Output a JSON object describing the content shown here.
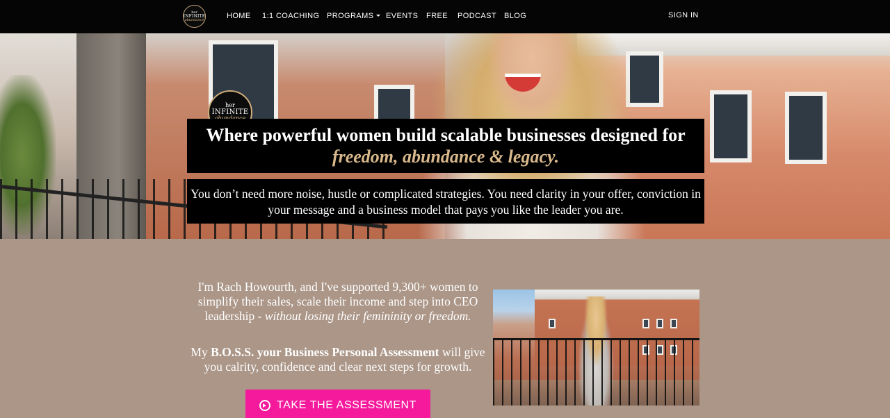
{
  "nav": {
    "logo": {
      "line1": "her",
      "line2": "INFINITE",
      "line3": "abundance"
    },
    "items": [
      {
        "label": "HOME"
      },
      {
        "label": "1:1 COACHING"
      },
      {
        "label": "PROGRAMS"
      },
      {
        "label": "EVENTS"
      },
      {
        "label": "FREE"
      },
      {
        "label": "PODCAST"
      },
      {
        "label": "BLOG"
      }
    ],
    "sign_in": "SIGN IN"
  },
  "hero": {
    "logo": {
      "line1": "her",
      "line2": "INFINITE",
      "line3": "abundance"
    },
    "headline": "Where powerful women build scalable businesses designed for",
    "headline_accent": "freedom, abundance & legacy.",
    "subheadline": "You don’t need more noise, hustle or complicated strategies. You need clarity in your offer, conviction in your message and a business model that pays you like the leader you are."
  },
  "intro": {
    "text": "I'm Rach Howourth, and I've supported 9,300+ women to simplify their sales, scale their income and step into CEO leadership - ",
    "emphasis": "without losing their femininity or freedom."
  },
  "assessment": {
    "prefix": "My ",
    "bold": "B.O.S.S. your Business Personal Assessment",
    "suffix": " will give you calrity, confidence and clear next steps for growth."
  },
  "cta": {
    "label": "TAKE THE ASSESSMENT",
    "icon": "arrow-circle-right-icon"
  },
  "colors": {
    "nav_bg": "#050505",
    "section_bg": "#ab9688",
    "accent_gold": "#d9b98b",
    "cta_pink": "#f5199b"
  }
}
